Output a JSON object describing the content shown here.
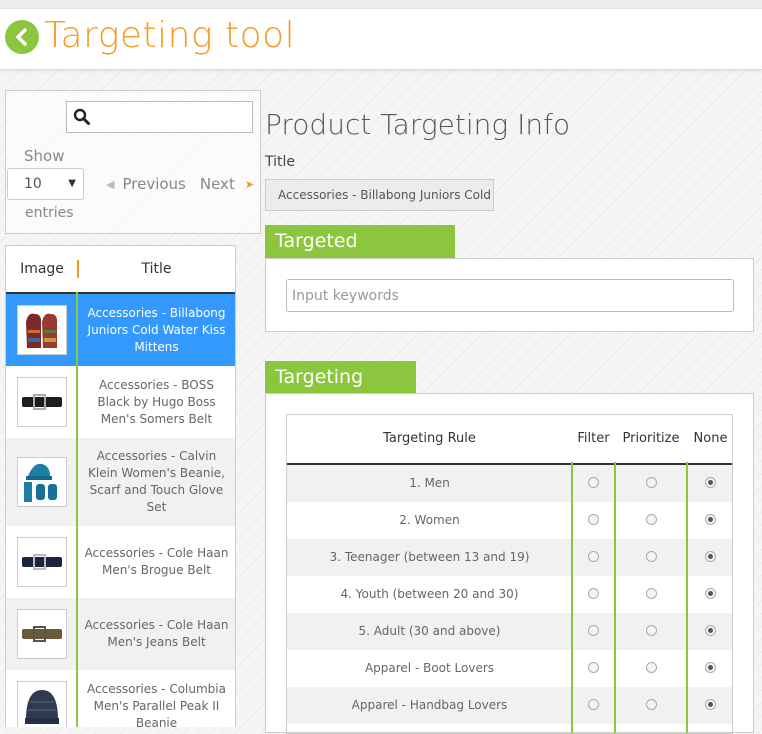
{
  "header": {
    "title": "Targeting tool"
  },
  "list_controls": {
    "search_value": "",
    "show_label": "Show",
    "page_size": "10",
    "entries_label": "entries",
    "previous_label": "Previous",
    "next_label": "Next"
  },
  "products_table": {
    "columns": {
      "image": "Image",
      "title": "Title"
    },
    "rows": [
      {
        "title": "Accessories - Billabong Juniors Cold Water Kiss Mittens",
        "thumb": "mittens-icon"
      },
      {
        "title": "Accessories - BOSS Black by Hugo Boss Men's Somers Belt",
        "thumb": "belt-icon"
      },
      {
        "title": "Accessories - Calvin Klein Women's Beanie, Scarf and Touch Glove Set",
        "thumb": "beanie-scarf-icon"
      },
      {
        "title": "Accessories - Cole Haan Men's Brogue Belt",
        "thumb": "belt-icon"
      },
      {
        "title": "Accessories - Cole Haan Men's Jeans Belt",
        "thumb": "belt-icon"
      },
      {
        "title": "Accessories - Columbia Men's Parallel Peak II Beanie",
        "thumb": "beanie-icon"
      }
    ]
  },
  "info": {
    "page_title": "Product Targeting Info",
    "title_label": "Title",
    "title_value": "Accessories - Billabong Juniors Cold Water Kiss Mittens"
  },
  "keywords": {
    "tab_label": "Targeted Keywords",
    "placeholder": "Input keywords"
  },
  "rules": {
    "tab_label": "Targeting Rules",
    "columns": {
      "rule": "Targeting Rule",
      "filter": "Filter",
      "prioritize": "Prioritize",
      "none": "None"
    },
    "rows": [
      {
        "name": "1. Men",
        "selected": "none"
      },
      {
        "name": "2. Women",
        "selected": "none"
      },
      {
        "name": "3. Teenager (between 13 and 19)",
        "selected": "none"
      },
      {
        "name": "4. Youth (between 20 and 30)",
        "selected": "none"
      },
      {
        "name": "5. Adult (30 and above)",
        "selected": "none"
      },
      {
        "name": "Apparel - Boot Lovers",
        "selected": "none"
      },
      {
        "name": "Apparel - Handbag Lovers",
        "selected": "none"
      }
    ]
  },
  "colors": {
    "accent_green": "#8cc63f",
    "accent_orange": "#f59a23",
    "selected_row": "#3399ff"
  }
}
